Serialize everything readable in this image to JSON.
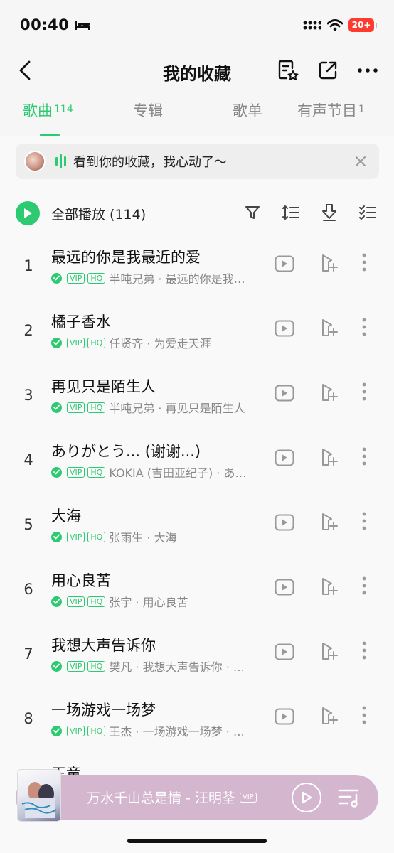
{
  "status_bar": {
    "time": "00:40",
    "battery": "20+"
  },
  "navbar": {
    "title": "我的收藏"
  },
  "tabs": [
    {
      "label": "歌曲",
      "count": "114"
    },
    {
      "label": "专辑",
      "count": ""
    },
    {
      "label": "歌单",
      "count": ""
    },
    {
      "label": "有声节目",
      "count": "1"
    }
  ],
  "banner": {
    "text": "看到你的收藏，我心动了～"
  },
  "play_all": {
    "label": "全部播放 (114)"
  },
  "songs": [
    {
      "index": "1",
      "title": "最远的你是我最近的爱",
      "tags": [
        "VIP",
        "HQ"
      ],
      "meta": "半吨兄弟 · 最远的你是我…"
    },
    {
      "index": "2",
      "title": "橘子香水",
      "tags": [
        "VIP",
        "HQ"
      ],
      "meta": "任贤齐 · 为爱走天涯"
    },
    {
      "index": "3",
      "title": "再见只是陌生人",
      "tags": [
        "VIP",
        "HQ"
      ],
      "meta": "半吨兄弟 · 再见只是陌生人"
    },
    {
      "index": "4",
      "title": "ありがとう... (谢谢...)",
      "tags": [
        "VIP",
        "HQ"
      ],
      "meta": "KOKIA (吉田亚纪子) · あ…"
    },
    {
      "index": "5",
      "title": "大海",
      "tags": [
        "VIP",
        "HQ"
      ],
      "meta": "张雨生 · 大海"
    },
    {
      "index": "6",
      "title": "用心良苦",
      "tags": [
        "VIP",
        "HQ"
      ],
      "meta": "张宇 · 用心良苦"
    },
    {
      "index": "7",
      "title": "我想大声告诉你",
      "tags": [
        "VIP",
        "HQ"
      ],
      "meta": "樊凡 · 我想大声告诉你 · …"
    },
    {
      "index": "8",
      "title": "一场游戏一场梦",
      "tags": [
        "VIP",
        "HQ"
      ],
      "meta": "王杰 · 一场游戏一场梦 · …"
    }
  ],
  "partial_song_title": "王童",
  "player": {
    "title": "万水千山总是情 - 汪明荃",
    "badge": "VIP"
  },
  "colors": {
    "accent": "#2dca72",
    "player_bg": "#d4b6cf"
  }
}
